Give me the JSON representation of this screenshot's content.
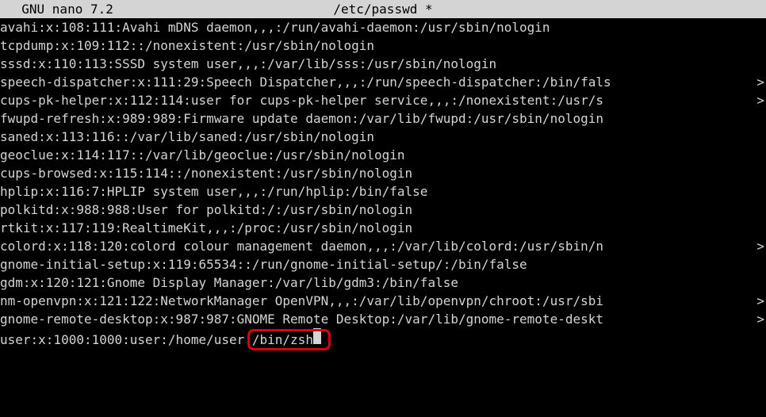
{
  "editor": {
    "name_version": "  GNU nano 7.2",
    "filename": "/etc/passwd *"
  },
  "file_lines": [
    {
      "text": "avahi:x:108:111:Avahi mDNS daemon,,,:/run/avahi-daemon:/usr/sbin/nologin",
      "truncated": false
    },
    {
      "text": "tcpdump:x:109:112::/nonexistent:/usr/sbin/nologin",
      "truncated": false
    },
    {
      "text": "sssd:x:110:113:SSSD system user,,,:/var/lib/sss:/usr/sbin/nologin",
      "truncated": false
    },
    {
      "text": "speech-dispatcher:x:111:29:Speech Dispatcher,,,:/run/speech-dispatcher:/bin/fals",
      "truncated": true
    },
    {
      "text": "cups-pk-helper:x:112:114:user for cups-pk-helper service,,,:/nonexistent:/usr/s",
      "truncated": true
    },
    {
      "text": "fwupd-refresh:x:989:989:Firmware update daemon:/var/lib/fwupd:/usr/sbin/nologin",
      "truncated": false
    },
    {
      "text": "saned:x:113:116::/var/lib/saned:/usr/sbin/nologin",
      "truncated": false
    },
    {
      "text": "geoclue:x:114:117::/var/lib/geoclue:/usr/sbin/nologin",
      "truncated": false
    },
    {
      "text": "cups-browsed:x:115:114::/nonexistent:/usr/sbin/nologin",
      "truncated": false
    },
    {
      "text": "hplip:x:116:7:HPLIP system user,,,:/run/hplip:/bin/false",
      "truncated": false
    },
    {
      "text": "polkitd:x:988:988:User for polkitd:/:/usr/sbin/nologin",
      "truncated": false
    },
    {
      "text": "rtkit:x:117:119:RealtimeKit,,,:/proc:/usr/sbin/nologin",
      "truncated": false
    },
    {
      "text": "colord:x:118:120:colord colour management daemon,,,:/var/lib/colord:/usr/sbin/n",
      "truncated": true
    },
    {
      "text": "gnome-initial-setup:x:119:65534::/run/gnome-initial-setup/:/bin/false",
      "truncated": false
    },
    {
      "text": "gdm:x:120:121:Gnome Display Manager:/var/lib/gdm3:/bin/false",
      "truncated": false
    },
    {
      "text": "nm-openvpn:x:121:122:NetworkManager OpenVPN,,,:/var/lib/openvpn/chroot:/usr/sbi",
      "truncated": true
    },
    {
      "text": "gnome-remote-desktop:x:987:987:GNOME Remote Desktop:/var/lib/gnome-remote-deskt",
      "truncated": true
    }
  ],
  "cursor_line": {
    "prefix": "user:x:1000:1000:user:/home/user:",
    "highlighted": "/bin/zsh"
  },
  "truncate_glyph": ">",
  "annotation": {
    "highlight_target": "/bin/zsh"
  }
}
